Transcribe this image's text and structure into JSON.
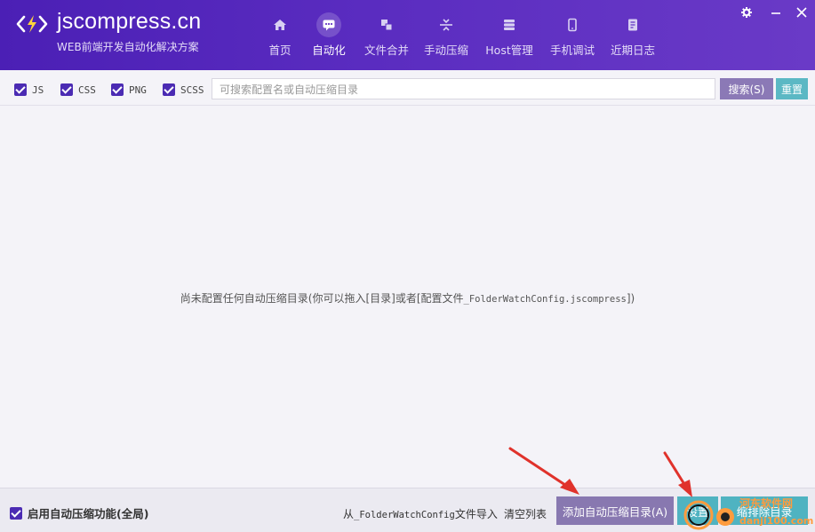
{
  "app": {
    "brand": "jscompress.cn",
    "tagline": "WEB前端开发自动化解决方案"
  },
  "nav": [
    {
      "label": "首页",
      "icon": "home-icon",
      "active": false
    },
    {
      "label": "自动化",
      "icon": "robot-icon",
      "active": true
    },
    {
      "label": "文件合并",
      "icon": "merge-icon",
      "active": false
    },
    {
      "label": "手动压缩",
      "icon": "compress-icon",
      "active": false
    },
    {
      "label": "Host管理",
      "icon": "server-icon",
      "active": false
    },
    {
      "label": "手机调试",
      "icon": "phone-icon",
      "active": false
    },
    {
      "label": "近期日志",
      "icon": "log-icon",
      "active": false
    }
  ],
  "window": {
    "settings_icon": "gear-icon",
    "minimize_icon": "minimize-icon",
    "close_icon": "close-icon"
  },
  "filters": [
    {
      "label": "JS",
      "checked": true
    },
    {
      "label": "CSS",
      "checked": true
    },
    {
      "label": "PNG",
      "checked": true
    },
    {
      "label": "SCSS",
      "checked": true
    }
  ],
  "search": {
    "placeholder": "可搜索配置名或自动压缩目录",
    "search_label": "搜索(S)",
    "reset_label": "重置"
  },
  "empty": {
    "message": "尚未配置任何自动压缩目录(你可以拖入[目录]或者[配置文件",
    "filename": "_FolderWatchConfig.jscompress",
    "suffix": "])"
  },
  "footer": {
    "global_toggle": "启用自动压缩功能(全局)",
    "import_prefix": "从",
    "import_file": "_FolderWatchConfig",
    "import_suffix": "文件导入",
    "clear_list": "清空列表",
    "add_dir": "添加自动压缩目录(A)",
    "settings": "设置",
    "exclude": "缩排除目录"
  },
  "watermark": {
    "line1": "河东软件网",
    "line2": "danji100.com"
  },
  "colors": {
    "header_start": "#4b1fb5",
    "header_end": "#6a3ac7",
    "accent": "#4b2bb3",
    "search_button": "#8b79b6",
    "reset_button": "#5bb8c4",
    "add_button": "#8878b0",
    "teal_button": "#4fb3c1",
    "arrow": "#e0322b"
  }
}
